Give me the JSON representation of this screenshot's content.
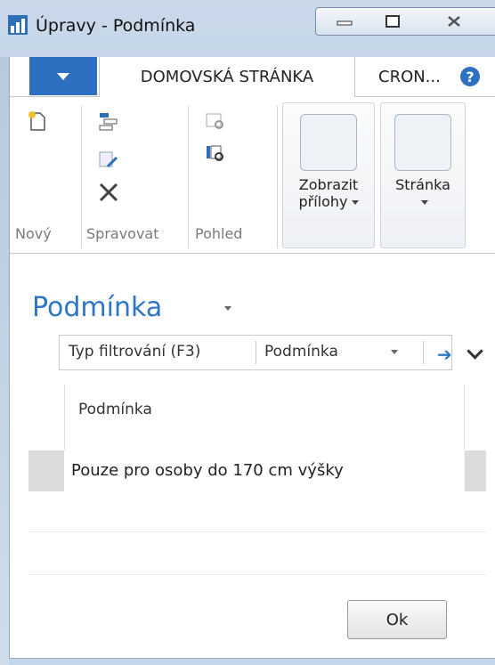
{
  "window": {
    "title": "Úpravy - Podmínka",
    "controls": [
      "minimize",
      "maximize",
      "close"
    ]
  },
  "tabs": {
    "home": "DOMOVSKÁ STRÁNKA",
    "cron": "CRON...",
    "help": "?"
  },
  "ribbon": {
    "groups": {
      "new": "Nový",
      "manage": "Spravovat",
      "view": "Pohled"
    },
    "show_attachments": "Zobrazit přílohy",
    "page": "Stránka"
  },
  "page": {
    "title": "Podmínka",
    "filter": {
      "placeholder": "Typ filtrování (F3)",
      "field": "Podmínka"
    }
  },
  "grid": {
    "columns": [
      "Podmínka"
    ],
    "rows": [
      [
        "Pouze pro osoby do 170 cm výšky"
      ]
    ]
  },
  "footer": {
    "ok": "Ok"
  },
  "colors": {
    "accent": "#2d6fc0",
    "title_blue": "#2e76c6",
    "selection": "#dcdcdc"
  },
  "icons": [
    "app-icon",
    "file-menu-icon",
    "help-icon",
    "new-icon",
    "edit-list-icon",
    "edit-icon",
    "delete-icon",
    "view-icon",
    "view-list-icon",
    "filter-arrow-icon",
    "chevron-down-icon"
  ]
}
